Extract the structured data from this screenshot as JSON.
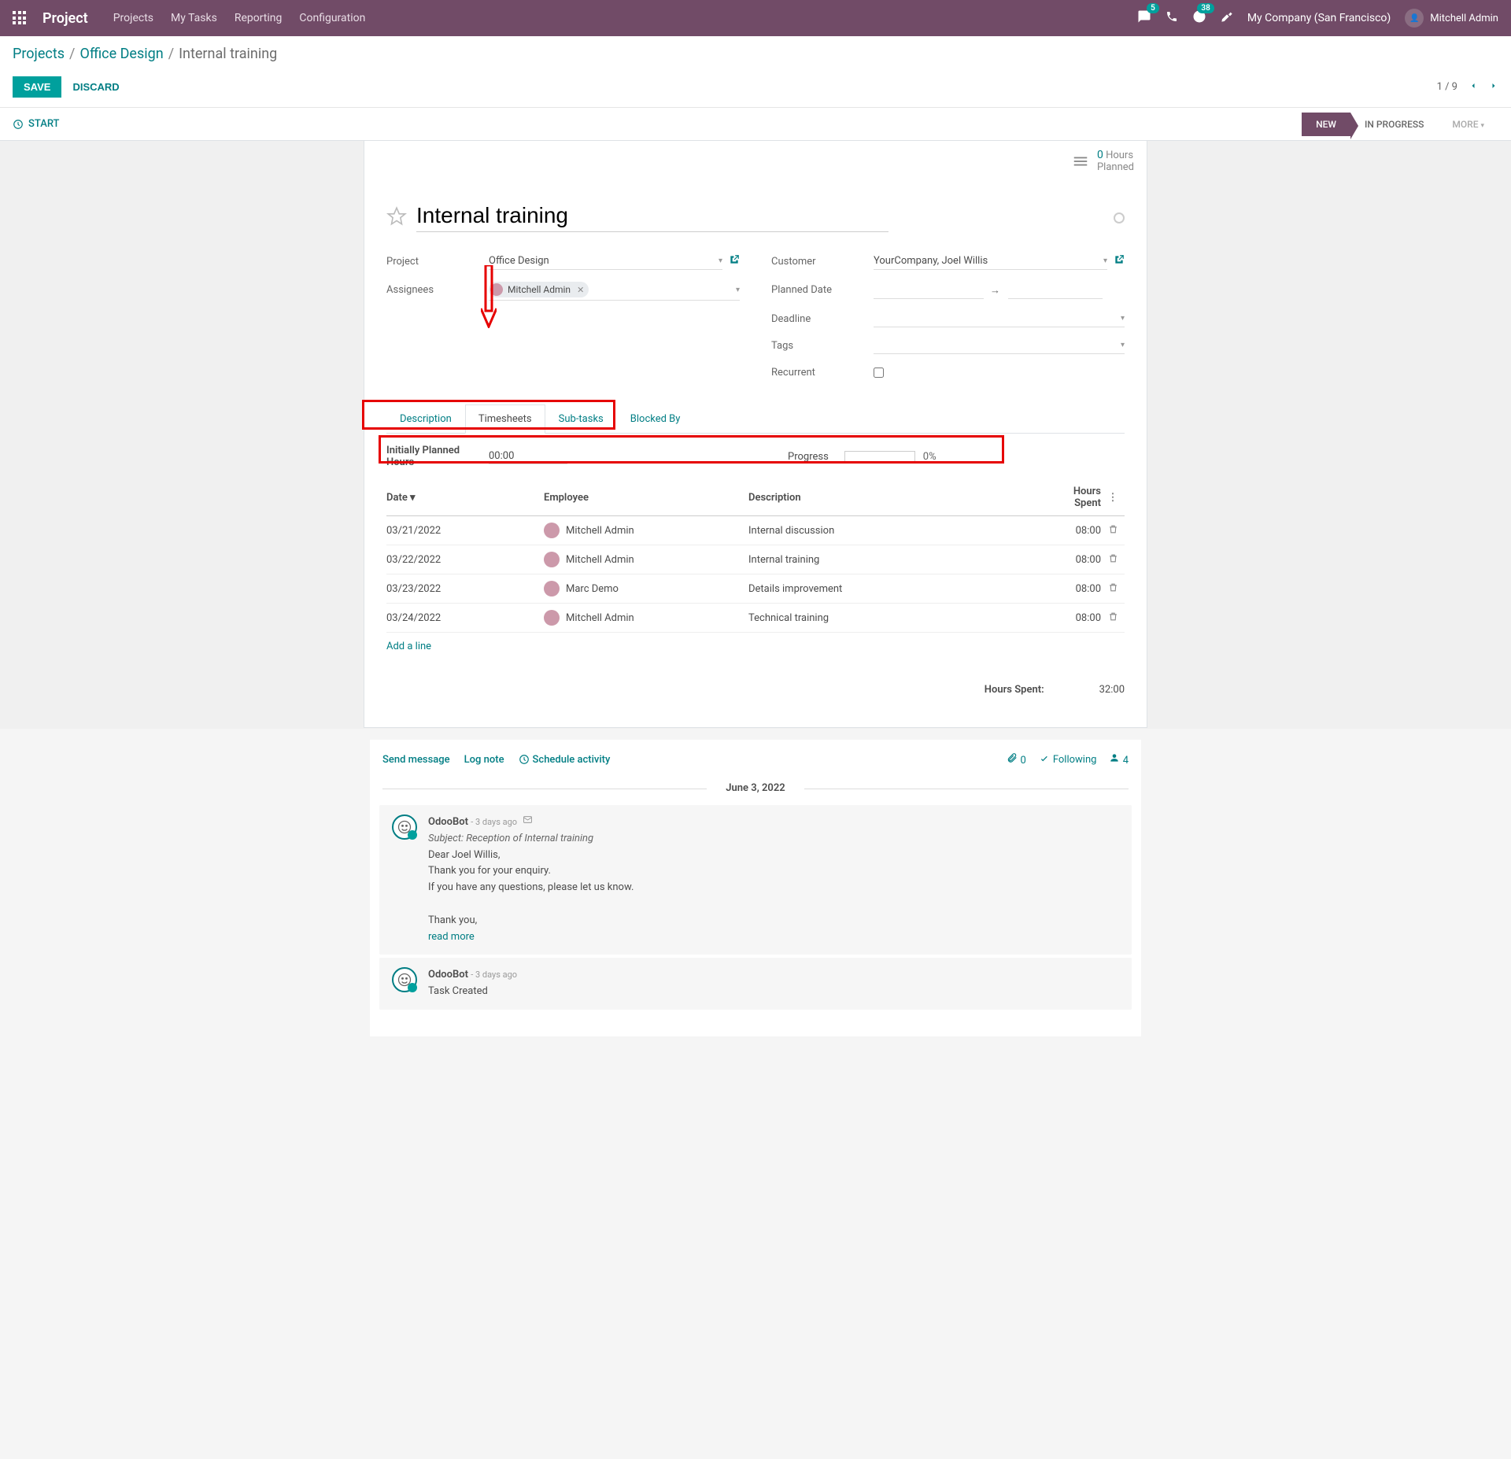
{
  "topbar": {
    "brand": "Project",
    "nav": [
      "Projects",
      "My Tasks",
      "Reporting",
      "Configuration"
    ],
    "msg_badge": "5",
    "activity_badge": "38",
    "company": "My Company (San Francisco)",
    "user": "Mitchell Admin"
  },
  "breadcrumb": {
    "l1": "Projects",
    "l2": "Office Design",
    "current": "Internal training"
  },
  "actions": {
    "save": "SAVE",
    "discard": "DISCARD",
    "pager": "1 / 9"
  },
  "statusbar": {
    "start": "START",
    "stages": [
      "NEW",
      "IN PROGRESS",
      "MORE"
    ]
  },
  "hours_button": {
    "count": "0",
    "unit": "Hours",
    "sub": "Planned"
  },
  "title": "Internal training",
  "fields": {
    "project_label": "Project",
    "project_value": "Office Design",
    "assignees_label": "Assignees",
    "assignees_value": "Mitchell Admin",
    "customer_label": "Customer",
    "customer_value": "YourCompany, Joel Willis",
    "planned_date_label": "Planned Date",
    "deadline_label": "Deadline",
    "tags_label": "Tags",
    "recurrent_label": "Recurrent"
  },
  "tabs": [
    "Description",
    "Timesheets",
    "Sub-tasks",
    "Blocked By"
  ],
  "planned": {
    "label": "Initially Planned Hours",
    "value": "00:00",
    "progress_label": "Progress",
    "progress_pct": "0%"
  },
  "ts_head": {
    "date": "Date",
    "employee": "Employee",
    "description": "Description",
    "hours": "Hours Spent"
  },
  "timesheets": [
    {
      "date": "03/21/2022",
      "employee": "Mitchell Admin",
      "desc": "Internal discussion",
      "hours": "08:00"
    },
    {
      "date": "03/22/2022",
      "employee": "Mitchell Admin",
      "desc": "Internal training",
      "hours": "08:00"
    },
    {
      "date": "03/23/2022",
      "employee": "Marc Demo",
      "desc": "Details improvement",
      "hours": "08:00"
    },
    {
      "date": "03/24/2022",
      "employee": "Mitchell Admin",
      "desc": "Technical training",
      "hours": "08:00"
    }
  ],
  "addline": "Add a line",
  "total": {
    "label": "Hours Spent:",
    "value": "32:00"
  },
  "chatter": {
    "send": "Send message",
    "log": "Log note",
    "schedule": "Schedule activity",
    "attach_count": "0",
    "following": "Following",
    "followers": "4",
    "date": "June 3, 2022",
    "msg1": {
      "author": "OdooBot",
      "time": "- 3 days ago",
      "subject": "Subject: Reception of Internal training",
      "l1": "Dear Joel Willis,",
      "l2": "Thank you for your enquiry.",
      "l3": "If you have any questions, please let us know.",
      "l4": "Thank you,",
      "readmore": "read more"
    },
    "msg2": {
      "author": "OdooBot",
      "time": "- 3 days ago",
      "body": "Task Created"
    }
  }
}
